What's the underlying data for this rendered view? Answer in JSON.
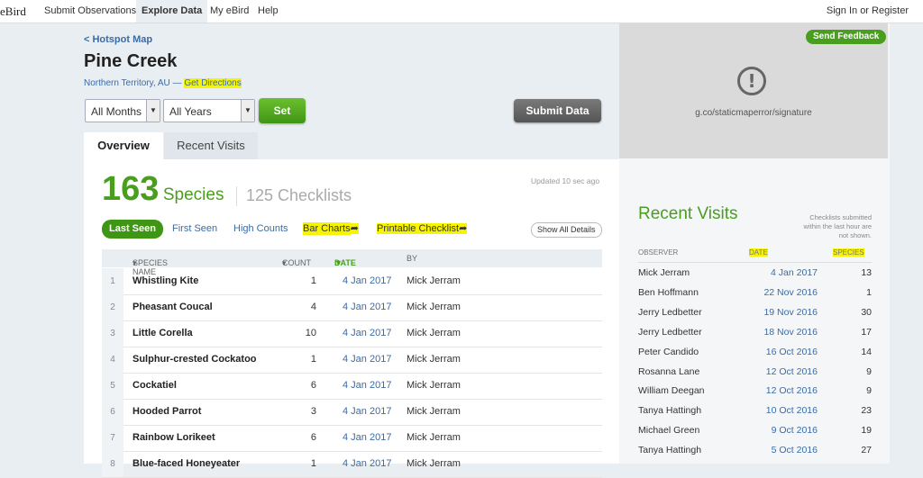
{
  "nav": {
    "logo": "eBird",
    "items": [
      "Submit Observations",
      "Explore Data",
      "My eBird",
      "Help"
    ],
    "active": "Explore Data",
    "signin": "Sign In or Register"
  },
  "header": {
    "back_link": "< Hotspot Map",
    "title": "Pine Creek",
    "location": "Northern Territory, AU",
    "separator": "—",
    "directions": "Get Directions"
  },
  "filters": {
    "months": "All Months",
    "years": "All Years",
    "set_label": "Set",
    "submit_label": "Submit Data"
  },
  "tabs": [
    "Overview",
    "Recent Visits"
  ],
  "stats": {
    "species_count": "163",
    "species_label": "Species",
    "checklists": "125 Checklists",
    "updated": "Updated 10 sec ago"
  },
  "view_filters": {
    "last_seen": "Last Seen",
    "first_seen": "First Seen",
    "high_counts": "High Counts",
    "bar_charts": "Bar Charts",
    "printable": "Printable Checklist",
    "show_all": "Show All Details"
  },
  "table": {
    "headers": {
      "name": "SPECIES NAME",
      "count": "COUNT",
      "date": "DATE",
      "by": "BY"
    },
    "rows": [
      {
        "num": "1",
        "name": "Whistling Kite",
        "count": "1",
        "date": "4 Jan 2017",
        "by": "Mick Jerram"
      },
      {
        "num": "2",
        "name": "Pheasant Coucal",
        "count": "4",
        "date": "4 Jan 2017",
        "by": "Mick Jerram"
      },
      {
        "num": "3",
        "name": "Little Corella",
        "count": "10",
        "date": "4 Jan 2017",
        "by": "Mick Jerram"
      },
      {
        "num": "4",
        "name": "Sulphur-crested Cockatoo",
        "count": "1",
        "date": "4 Jan 2017",
        "by": "Mick Jerram"
      },
      {
        "num": "5",
        "name": "Cockatiel",
        "count": "6",
        "date": "4 Jan 2017",
        "by": "Mick Jerram"
      },
      {
        "num": "6",
        "name": "Hooded Parrot",
        "count": "3",
        "date": "4 Jan 2017",
        "by": "Mick Jerram"
      },
      {
        "num": "7",
        "name": "Rainbow Lorikeet",
        "count": "6",
        "date": "4 Jan 2017",
        "by": "Mick Jerram"
      },
      {
        "num": "8",
        "name": "Blue-faced Honeyeater",
        "count": "1",
        "date": "4 Jan 2017",
        "by": "Mick Jerram"
      }
    ]
  },
  "map": {
    "error_text": "g.co/staticmaperror/signature",
    "feedback": "Send Feedback"
  },
  "recent_visits": {
    "title": "Recent Visits",
    "note": "Checklists submitted within the last hour are not shown.",
    "headers": {
      "observer": "OBSERVER",
      "date": "DATE",
      "species": "SPECIES"
    },
    "rows": [
      {
        "observer": "Mick Jerram",
        "date": "4 Jan 2017",
        "species": "13"
      },
      {
        "observer": "Ben Hoffmann",
        "date": "22 Nov 2016",
        "species": "1"
      },
      {
        "observer": "Jerry Ledbetter",
        "date": "19 Nov 2016",
        "species": "30"
      },
      {
        "observer": "Jerry Ledbetter",
        "date": "18 Nov 2016",
        "species": "17"
      },
      {
        "observer": "Peter Candido",
        "date": "16 Oct 2016",
        "species": "14"
      },
      {
        "observer": "Rosanna Lane",
        "date": "12 Oct 2016",
        "species": "9"
      },
      {
        "observer": "William Deegan",
        "date": "12 Oct 2016",
        "species": "9"
      },
      {
        "observer": "Tanya Hattingh",
        "date": "10 Oct 2016",
        "species": "23"
      },
      {
        "observer": "Michael Green",
        "date": "9 Oct 2016",
        "species": "19"
      },
      {
        "observer": "Tanya Hattingh",
        "date": "5 Oct 2016",
        "species": "27"
      }
    ]
  },
  "colors": {
    "accent": "#4a9e1f",
    "link": "#3b6ba5",
    "highlight": "#f6f400"
  }
}
